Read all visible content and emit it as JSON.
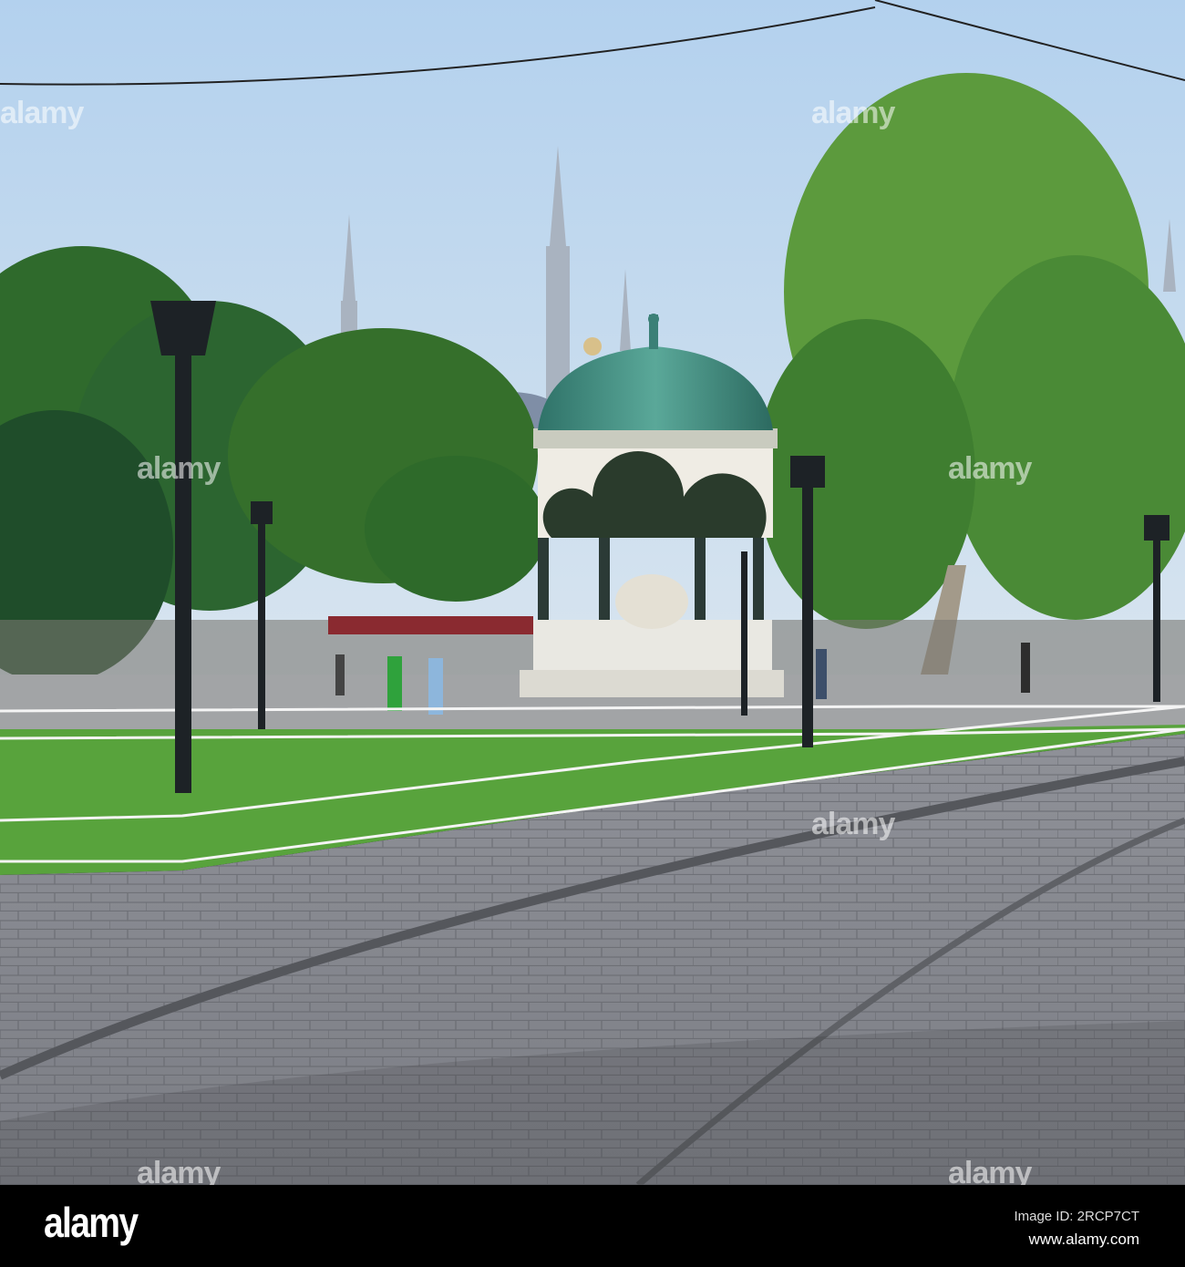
{
  "watermark": {
    "text": "alamy"
  },
  "footer": {
    "logo": "alamy",
    "image_id": "Image ID: 2RCP7CT",
    "website": "www.alamy.com"
  },
  "colors": {
    "sky": "#c6dcef",
    "dome": "#3f8a7e",
    "grass": "#55a23a",
    "pavement": "#8a8c92",
    "footer": "#000000"
  }
}
